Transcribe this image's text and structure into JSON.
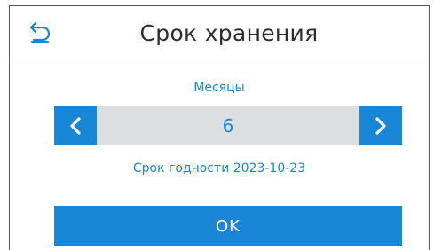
{
  "header": {
    "title": "Срок хранения",
    "back_icon": "back-arrow-icon"
  },
  "stepper": {
    "label": "Месяцы",
    "value": "6",
    "decrement_icon": "chevron-left-icon",
    "increment_icon": "chevron-right-icon"
  },
  "expiry_text": "Срок годности 2023-10-23",
  "ok_label": "OK",
  "colors": {
    "accent": "#1a86d6",
    "stepper_bg": "#dcdfe2",
    "title_text": "#2a2d31"
  }
}
